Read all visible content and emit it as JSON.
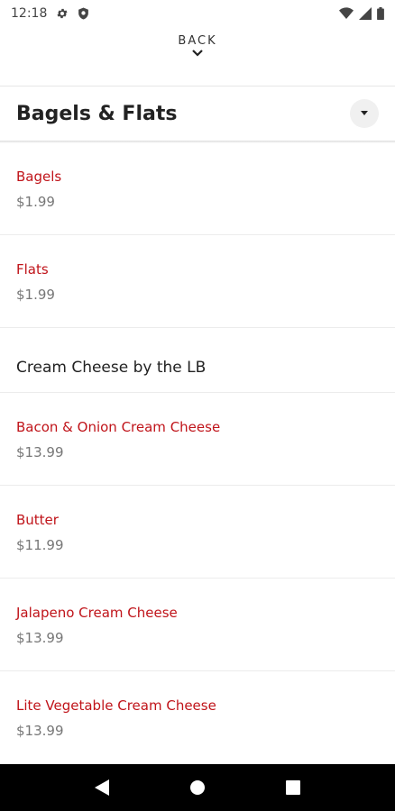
{
  "status_bar": {
    "time": "12:18",
    "icons": [
      "gear-icon",
      "shield-icon",
      "wifi-icon",
      "signal-icon",
      "battery-icon"
    ]
  },
  "back": {
    "label": "BACK"
  },
  "category": {
    "title": "Bagels & Flats"
  },
  "colors": {
    "item_name": "#c0141a",
    "price": "#777777",
    "nav_bar": "#000000"
  },
  "group1": [
    {
      "name": "Bagels",
      "price": "$1.99"
    },
    {
      "name": "Flats",
      "price": "$1.99"
    }
  ],
  "section": {
    "title": "Cream Cheese by the LB"
  },
  "group2": [
    {
      "name": "Bacon & Onion Cream Cheese",
      "price": "$13.99"
    },
    {
      "name": "Butter",
      "price": "$11.99"
    },
    {
      "name": "Jalapeno Cream Cheese",
      "price": "$13.99"
    },
    {
      "name": "Lite Vegetable Cream Cheese",
      "price": "$13.99"
    }
  ],
  "nav": {
    "icons": [
      "back-triangle-icon",
      "home-circle-icon",
      "recents-square-icon"
    ]
  }
}
